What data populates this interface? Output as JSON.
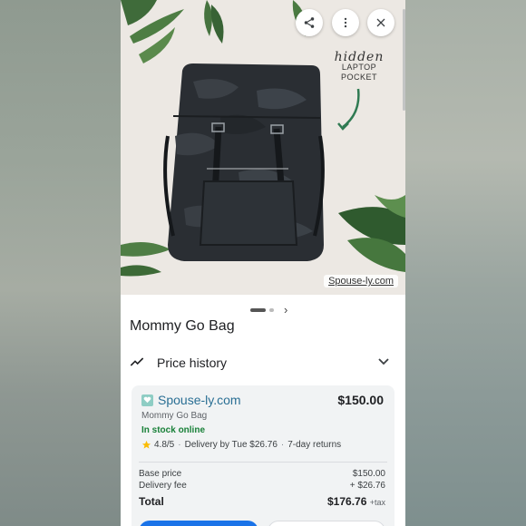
{
  "hero": {
    "callout_script": "hidden",
    "callout_line1": "LAPTOP",
    "callout_line2": "POCKET",
    "watermark": "Spouse-ly.com",
    "image_count": 2,
    "active_index": 1
  },
  "product": {
    "title": "Mommy Go Bag"
  },
  "price_history": {
    "label": "Price history"
  },
  "offer": {
    "store": "Spouse-ly.com",
    "price": "$150.00",
    "product_name": "Mommy Go Bag",
    "stock": "In stock online",
    "rating": "4.8/5",
    "delivery": "Delivery by Tue $26.76",
    "returns": "7-day returns",
    "breakdown": {
      "base_label": "Base price",
      "base_value": "$150.00",
      "delivery_label": "Delivery fee",
      "delivery_value": "+ $26.76",
      "total_label": "Total",
      "total_value": "$176.76",
      "tax_label": "+tax"
    }
  },
  "icons": [
    "share-icon",
    "more-vert-icon",
    "close-icon",
    "chevron-right-icon",
    "trending-icon",
    "chevron-down-icon",
    "star-icon",
    "store-heart-icon"
  ],
  "colors": {
    "link": "#2a6f94",
    "in_stock": "#188038",
    "primary_button": "#1a73e8",
    "star": "#fbbc04"
  }
}
